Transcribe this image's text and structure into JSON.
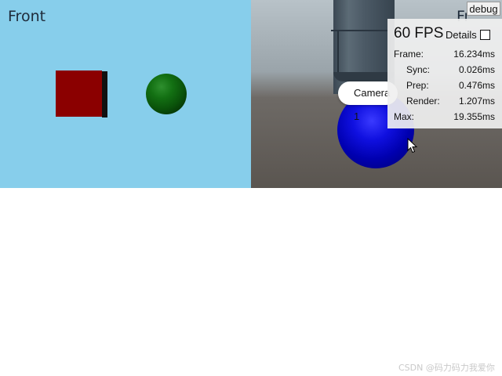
{
  "left_view": {
    "title": "Front"
  },
  "right_view": {
    "title_partial": "Fr",
    "camera_button": "Camera 1"
  },
  "stats": {
    "fps": "60 FPS",
    "details_label": "Details",
    "rows": [
      {
        "label": "Frame:",
        "value": "16.234ms"
      },
      {
        "label": "Sync:",
        "value": "0.026ms"
      },
      {
        "label": "Prep:",
        "value": "0.476ms"
      },
      {
        "label": "Render:",
        "value": "1.207ms"
      },
      {
        "label": "Max:",
        "value": "19.355ms"
      }
    ]
  },
  "debug_button": "debug",
  "watermark": "CSDN @码力码力我爱你",
  "colors": {
    "left_background": "#87ceeb",
    "cube": "#8b0000",
    "green_sphere": "#137013",
    "blue_sphere": "#0000cc"
  },
  "icons": {
    "cursor": "arrow-cursor-icon"
  }
}
